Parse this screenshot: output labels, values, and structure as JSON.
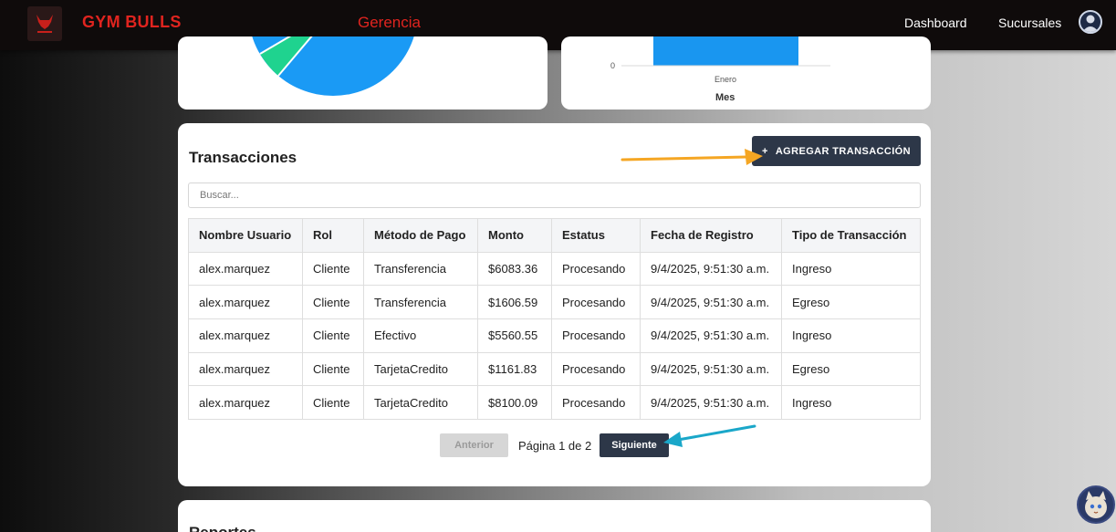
{
  "brand": {
    "name": "GYM BULLS",
    "section": "Gerencia"
  },
  "nav": {
    "links": [
      "Dashboard",
      "Sucursales"
    ]
  },
  "bar_chart": {
    "y_tick": "0",
    "x_tick": "Enero",
    "xlabel": "Mes",
    "bar_color": "#1996f0"
  },
  "pie_chart": {
    "colors": [
      "#1fd38f",
      "#1a9af5"
    ]
  },
  "transactions": {
    "title": "Transacciones",
    "add_button": "AGREGAR TRANSACCIÓN",
    "add_icon": "+",
    "search_placeholder": "Buscar...",
    "columns": [
      "Nombre Usuario",
      "Rol",
      "Método de Pago",
      "Monto",
      "Estatus",
      "Fecha de Registro",
      "Tipo de Transacción"
    ],
    "rows": [
      [
        "alex.marquez",
        "Cliente",
        "Transferencia",
        "$6083.36",
        "Procesando",
        "9/4/2025, 9:51:30 a.m.",
        "Ingreso"
      ],
      [
        "alex.marquez",
        "Cliente",
        "Transferencia",
        "$1606.59",
        "Procesando",
        "9/4/2025, 9:51:30 a.m.",
        "Egreso"
      ],
      [
        "alex.marquez",
        "Cliente",
        "Efectivo",
        "$5560.55",
        "Procesando",
        "9/4/2025, 9:51:30 a.m.",
        "Ingreso"
      ],
      [
        "alex.marquez",
        "Cliente",
        "TarjetaCredito",
        "$1161.83",
        "Procesando",
        "9/4/2025, 9:51:30 a.m.",
        "Egreso"
      ],
      [
        "alex.marquez",
        "Cliente",
        "TarjetaCredito",
        "$8100.09",
        "Procesando",
        "9/4/2025, 9:51:30 a.m.",
        "Ingreso"
      ]
    ],
    "pager": {
      "prev": "Anterior",
      "info": "Página 1 de 2",
      "next": "Siguiente"
    }
  },
  "reports": {
    "title": "Reportes"
  },
  "colors": {
    "accent_red": "#e0241f",
    "button_dark": "#2d3748",
    "arrow_orange": "#f5a623",
    "arrow_blue": "#1aa7c9"
  }
}
